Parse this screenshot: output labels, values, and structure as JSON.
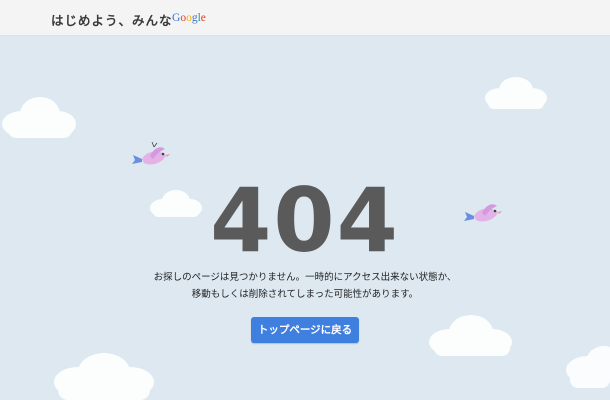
{
  "header": {
    "brand_text": "はじめよう、みんな",
    "google_logo": {
      "letters": [
        "G",
        "o",
        "o",
        "g",
        "l",
        "e"
      ],
      "colors": [
        "#3c6fd8",
        "#d8412f",
        "#f0b400",
        "#3c6fd8",
        "#2c9d4c",
        "#d8412f"
      ]
    }
  },
  "error": {
    "code": "404",
    "message_line1": "お探しのページは見つかりません。一時的にアクセス出来ない状態か、",
    "message_line2": "移動もしくは削除されてしまった可能性があります。"
  },
  "button": {
    "label": "トップページに戻る",
    "color": "#3f7fe0"
  },
  "colors": {
    "background": "#dde8f0",
    "header_bg": "#f4f4f4",
    "code_text": "#5a5a5a",
    "bird": "#e3b3e8"
  },
  "decorations": {
    "clouds": 6,
    "birds": 2
  }
}
